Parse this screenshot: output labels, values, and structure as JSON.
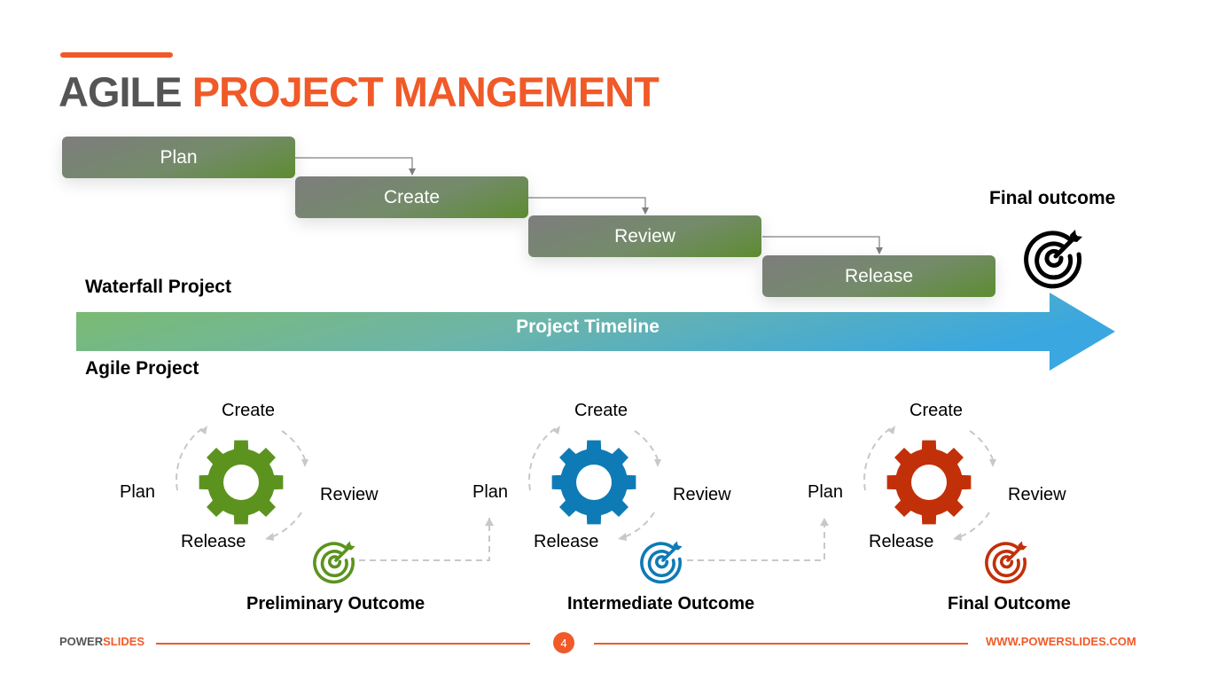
{
  "title": {
    "part1": "AGILE",
    "part2": "PROJECT MANGEMENT"
  },
  "colors": {
    "accent": "#f05a28",
    "green": "#5c931f",
    "blue": "#0e7bb6",
    "red": "#c23009"
  },
  "waterfall": {
    "label": "Waterfall Project",
    "steps": [
      {
        "label": "Plan"
      },
      {
        "label": "Create"
      },
      {
        "label": "Review"
      },
      {
        "label": "Release"
      }
    ],
    "final_outcome": {
      "label": "Final outcome",
      "icon": "target-arrow-icon"
    }
  },
  "timeline": {
    "label": "Project Timeline"
  },
  "agile": {
    "label": "Agile Project",
    "cycles": [
      {
        "create": "Create",
        "plan": "Plan",
        "review": "Review",
        "release": "Release",
        "outcome": "Preliminary Outcome",
        "color": "#5c931f"
      },
      {
        "create": "Create",
        "plan": "Plan",
        "review": "Review",
        "release": "Release",
        "outcome": "Intermediate Outcome",
        "color": "#0e7bb6"
      },
      {
        "create": "Create",
        "plan": "Plan",
        "review": "Review",
        "release": "Release",
        "outcome": "Final Outcome",
        "color": "#c23009"
      }
    ]
  },
  "footer": {
    "brand1": "POWER",
    "brand2": "SLIDES",
    "page": "4",
    "url": "WWW.POWERSLIDES.COM"
  }
}
